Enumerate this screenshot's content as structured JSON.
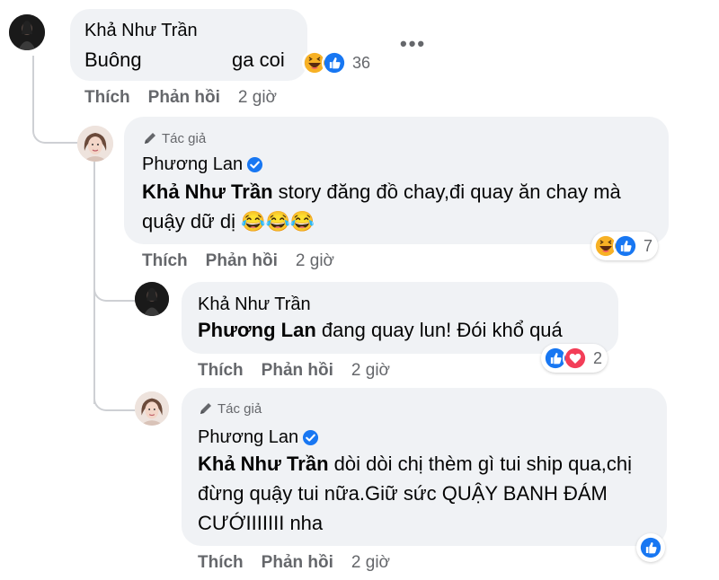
{
  "comments": [
    {
      "author": "Khả Như Trần",
      "text": "Buông",
      "text_tail": "ga coi",
      "reaction_count": "36",
      "actions": {
        "like": "Thích",
        "reply": "Phản hồi",
        "time": "2 giờ"
      },
      "more_label": "•••"
    },
    {
      "author_tag": "Tác giả",
      "author": "Phương Lan",
      "mention": "Khả Như Trần",
      "text": " story đăng đồ chay,đi quay ăn chay mà quậy dữ dị 😂😂😂",
      "reaction_count": "7",
      "actions": {
        "like": "Thích",
        "reply": "Phản hồi",
        "time": "2 giờ"
      }
    },
    {
      "author": "Khả Như Trần",
      "mention": "Phương Lan",
      "text": " đang quay lun! Đói khổ quá",
      "reaction_count": "2",
      "actions": {
        "like": "Thích",
        "reply": "Phản hồi",
        "time": "2 giờ"
      }
    },
    {
      "author_tag": "Tác giả",
      "author": "Phương Lan",
      "mention": "Khả Như Trần",
      "text": " dòi dòi chị thèm gì tui ship qua,chị đừng quậy tui nữa.Giữ sức QUẬY BANH ĐÁM CƯỚIIIIIII nha",
      "actions": {
        "like": "Thích",
        "reply": "Phản hồi",
        "time": "2 giờ"
      }
    }
  ],
  "colors": {
    "bubble": "#f0f2f5",
    "like_blue": "#1877f2",
    "love_red": "#f33e58",
    "haha_yellow": "#f7b125",
    "secondary_text": "#65676b"
  },
  "icons": [
    "avatar-dark",
    "avatar-woman",
    "verified-badge-icon",
    "pencil-icon",
    "like-reaction-icon",
    "haha-reaction-icon",
    "love-reaction-icon"
  ]
}
